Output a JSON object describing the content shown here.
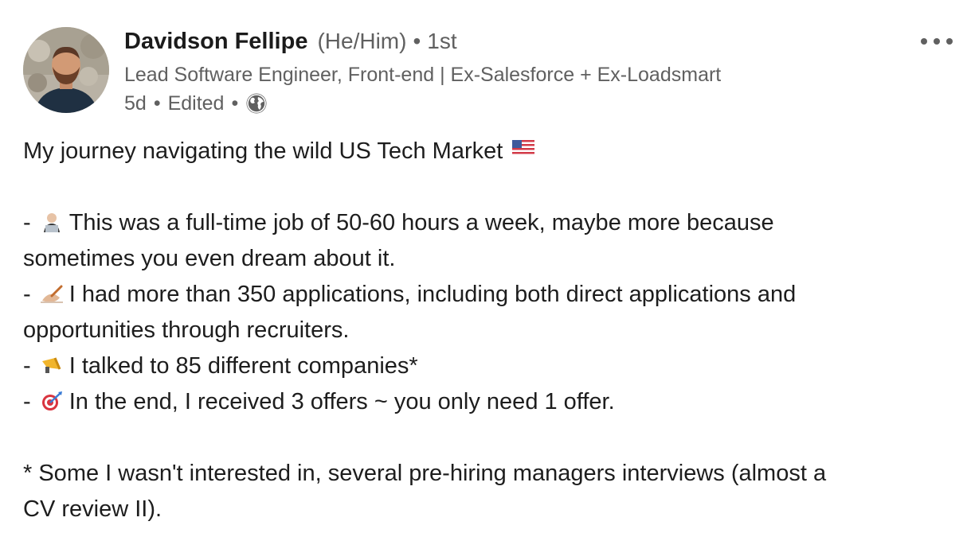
{
  "post": {
    "author": {
      "name": "Davidson Fellipe",
      "pronouns": "(He/Him)",
      "degree": "1st",
      "headline": "Lead Software Engineer, Front-end | Ex-Salesforce + Ex-Loadsmart"
    },
    "meta": {
      "age": "5d",
      "edited": "Edited",
      "visibility_icon": "globe-icon"
    },
    "more_icon": "ellipsis-icon",
    "title": "My journey navigating the wild US Tech Market",
    "title_emoji": "us-flag-emoji",
    "bullets": [
      {
        "prefix": "-",
        "emoji": "technologist-emoji",
        "text_line1": "This was a full-time job of 50-60 hours a week, maybe more because",
        "text_line2": "sometimes you even dream about it."
      },
      {
        "prefix": "-",
        "emoji": "writing-hand-emoji",
        "text_line1": "I had more than 350 applications, including both direct applications and",
        "text_line2": "opportunities through recruiters."
      },
      {
        "prefix": "-",
        "emoji": "megaphone-emoji",
        "text_line1": "I talked to 85 different companies*"
      },
      {
        "prefix": "-",
        "emoji": "direct-hit-emoji",
        "text_line1": "In the end, I received 3 offers ~ you only need 1 offer."
      }
    ],
    "footnote_line1": "* Some I wasn't interested in, several pre-hiring managers interviews (almost a",
    "footnote_line2": "CV review II).",
    "colors": {
      "text": "#1d1d1d",
      "secondary_text": "#606060"
    }
  }
}
